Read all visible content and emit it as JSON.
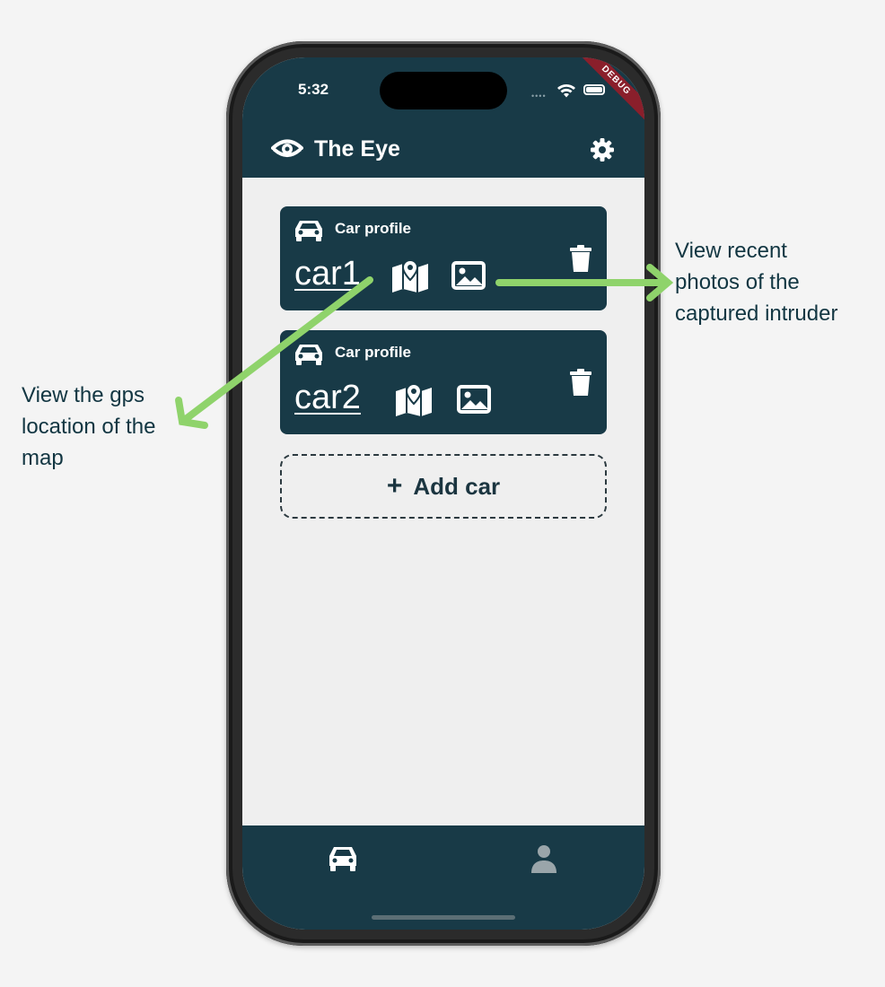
{
  "status_bar": {
    "time": "5:32",
    "debug_banner": "DEBUG"
  },
  "app_bar": {
    "title": "The Eye",
    "leading_icon": "eye-icon",
    "action_icon": "gear-icon"
  },
  "cars": [
    {
      "label": "Car profile",
      "name": "car1"
    },
    {
      "label": "Car profile",
      "name": "car2"
    }
  ],
  "add_car": {
    "plus": "+",
    "label": "Add car"
  },
  "bottom_nav": {
    "items": [
      "car-icon",
      "person-icon"
    ]
  },
  "annotations": {
    "photos_lines": [
      "View recent",
      "photos of the",
      "captured intruder"
    ],
    "gps_lines": [
      "View the gps",
      "location of the",
      "map"
    ],
    "arrow_color": "#8fd36b"
  },
  "colors": {
    "primary": "#183a47",
    "background": "#efefef",
    "page": "#f4f4f4"
  }
}
